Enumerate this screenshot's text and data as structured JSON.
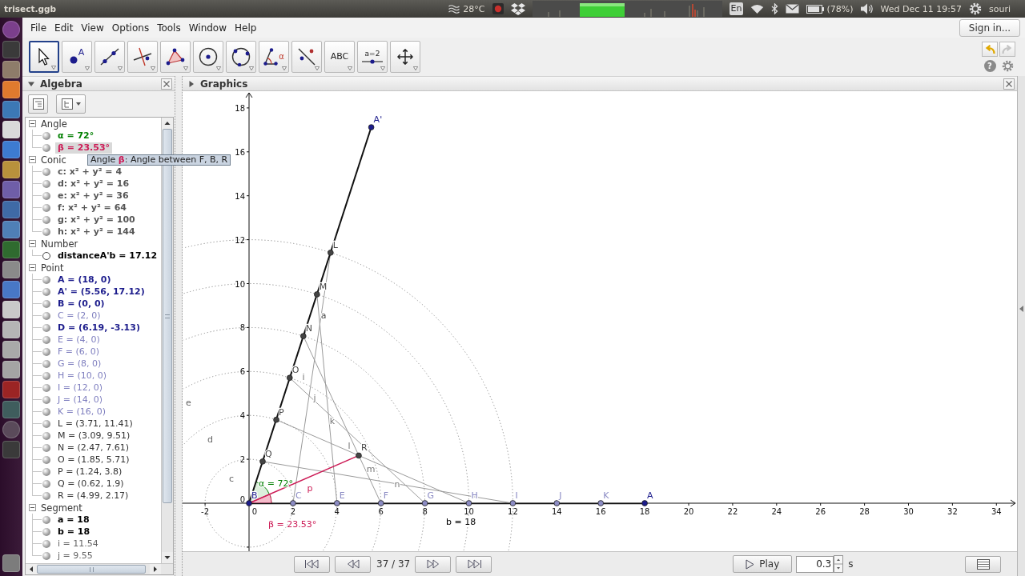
{
  "system_bar": {
    "title": "trisect.ggb",
    "temperature": "28°C",
    "keyboard_layout": "En",
    "battery": "(78%)",
    "clock": "Wed Dec 11 19:57",
    "user": "souri"
  },
  "menu": [
    "File",
    "Edit",
    "View",
    "Options",
    "Tools",
    "Window",
    "Help"
  ],
  "sign_in": "Sign in...",
  "tools": [
    {
      "kind": "move",
      "selected": true
    },
    {
      "kind": "point",
      "label": "A",
      "selected": false
    },
    {
      "kind": "line",
      "selected": false
    },
    {
      "kind": "perpendicular",
      "selected": false
    },
    {
      "kind": "polygon",
      "selected": false
    },
    {
      "kind": "circle_center",
      "selected": false
    },
    {
      "kind": "circle_three",
      "selected": false
    },
    {
      "kind": "angle",
      "label": "α",
      "selected": false
    },
    {
      "kind": "reflect",
      "selected": false
    },
    {
      "kind": "text",
      "label": "ABC",
      "selected": false
    },
    {
      "kind": "slider",
      "label": "a=2",
      "selected": false
    },
    {
      "kind": "move_view",
      "selected": false
    }
  ],
  "help": "?",
  "algebra": {
    "title": "Algebra",
    "expanded": true,
    "groups": [
      {
        "name": "Angle",
        "expanded": true,
        "items": [
          {
            "text": "α = 72°",
            "color": "#007f00",
            "bold": true,
            "visible": true,
            "selected": false
          },
          {
            "text": "β = 23.53°",
            "color": "#cc1a55",
            "bold": true,
            "visible": true,
            "selected": true
          }
        ]
      },
      {
        "name": "Conic",
        "expanded": true,
        "items": [
          {
            "text": "c: x² + y² = 4",
            "color": "#555555",
            "bold": true,
            "visible": true,
            "selected": false
          },
          {
            "text": "d: x² + y² = 16",
            "color": "#555555",
            "bold": true,
            "visible": true,
            "selected": false
          },
          {
            "text": "e: x² + y² = 36",
            "color": "#555555",
            "bold": true,
            "visible": true,
            "selected": false
          },
          {
            "text": "f: x² + y² = 64",
            "color": "#555555",
            "bold": true,
            "visible": true,
            "selected": false
          },
          {
            "text": "g: x² + y² = 100",
            "color": "#555555",
            "bold": true,
            "visible": true,
            "selected": false
          },
          {
            "text": "h: x² + y² = 144",
            "color": "#555555",
            "bold": true,
            "visible": true,
            "selected": false
          }
        ]
      },
      {
        "name": "Number",
        "expanded": true,
        "items": [
          {
            "text": "distanceA'b = 17.12",
            "color": "#000000",
            "bold": true,
            "visible": false,
            "selected": false
          }
        ]
      },
      {
        "name": "Point",
        "expanded": true,
        "items": [
          {
            "text": "A = (18, 0)",
            "color": "#1c1c8c",
            "bold": true,
            "visible": true,
            "selected": false
          },
          {
            "text": "A' = (5.56, 17.12)",
            "color": "#1c1c8c",
            "bold": true,
            "visible": true,
            "selected": false
          },
          {
            "text": "B = (0, 0)",
            "color": "#1c1c8c",
            "bold": true,
            "visible": true,
            "selected": false
          },
          {
            "text": "C = (2, 0)",
            "color": "#7f7fbf",
            "bold": false,
            "visible": true,
            "selected": false
          },
          {
            "text": "D = (6.19, -3.13)",
            "color": "#1c1c8c",
            "bold": true,
            "visible": true,
            "selected": false
          },
          {
            "text": "E = (4, 0)",
            "color": "#7f7fbf",
            "bold": false,
            "visible": true,
            "selected": false
          },
          {
            "text": "F = (6, 0)",
            "color": "#7f7fbf",
            "bold": false,
            "visible": true,
            "selected": false
          },
          {
            "text": "G = (8, 0)",
            "color": "#7f7fbf",
            "bold": false,
            "visible": true,
            "selected": false
          },
          {
            "text": "H = (10, 0)",
            "color": "#7f7fbf",
            "bold": false,
            "visible": true,
            "selected": false
          },
          {
            "text": "I = (12, 0)",
            "color": "#7f7fbf",
            "bold": false,
            "visible": true,
            "selected": false
          },
          {
            "text": "J = (14, 0)",
            "color": "#7f7fbf",
            "bold": false,
            "visible": true,
            "selected": false
          },
          {
            "text": "K = (16, 0)",
            "color": "#7f7fbf",
            "bold": false,
            "visible": true,
            "selected": false
          },
          {
            "text": "L = (3.71, 11.41)",
            "color": "#333333",
            "bold": false,
            "visible": true,
            "selected": false
          },
          {
            "text": "M = (3.09, 9.51)",
            "color": "#333333",
            "bold": false,
            "visible": true,
            "selected": false
          },
          {
            "text": "N = (2.47, 7.61)",
            "color": "#333333",
            "bold": false,
            "visible": true,
            "selected": false
          },
          {
            "text": "O = (1.85, 5.71)",
            "color": "#333333",
            "bold": false,
            "visible": true,
            "selected": false
          },
          {
            "text": "P = (1.24, 3.8)",
            "color": "#333333",
            "bold": false,
            "visible": true,
            "selected": false
          },
          {
            "text": "Q = (0.62, 1.9)",
            "color": "#333333",
            "bold": false,
            "visible": true,
            "selected": false
          },
          {
            "text": "R = (4.99, 2.17)",
            "color": "#333333",
            "bold": false,
            "visible": true,
            "selected": false
          }
        ]
      },
      {
        "name": "Segment",
        "expanded": true,
        "items": [
          {
            "text": "a = 18",
            "color": "#000000",
            "bold": true,
            "visible": true,
            "selected": false
          },
          {
            "text": "b = 18",
            "color": "#000000",
            "bold": true,
            "visible": true,
            "selected": false
          },
          {
            "text": "i = 11.54",
            "color": "#666666",
            "bold": false,
            "visible": true,
            "selected": false
          },
          {
            "text": "j = 9.55",
            "color": "#666666",
            "bold": false,
            "visible": true,
            "selected": false
          }
        ]
      }
    ]
  },
  "tooltip": "Angle **β**: Angle between F, B, R",
  "graphics": {
    "title": "Graphics",
    "expanded": false,
    "x_ticks": [
      "-2",
      "0",
      "2",
      "4",
      "6",
      "8",
      "10",
      "12",
      "14",
      "16",
      "18",
      "20",
      "22",
      "24",
      "26",
      "28",
      "30",
      "32",
      "34"
    ],
    "y_ticks": [
      "18",
      "16",
      "14",
      "12",
      "10",
      "8",
      "6",
      "4",
      "2",
      "0"
    ],
    "points": [
      {
        "label": "A'",
        "color": "#1c1c8c"
      },
      {
        "label": "L",
        "color": "#444444"
      },
      {
        "label": "M",
        "color": "#444444"
      },
      {
        "label": "N",
        "color": "#444444"
      },
      {
        "label": "O",
        "color": "#444444"
      },
      {
        "label": "P",
        "color": "#444444"
      },
      {
        "label": "Q",
        "color": "#444444"
      },
      {
        "label": "R",
        "color": "#444444"
      },
      {
        "label": "B",
        "color": "#1c1c8c"
      },
      {
        "label": "C",
        "color": "#8c8cc4"
      },
      {
        "label": "E",
        "color": "#8c8cc4"
      },
      {
        "label": "F",
        "color": "#8c8cc4"
      },
      {
        "label": "G",
        "color": "#8c8cc4"
      },
      {
        "label": "H",
        "color": "#8c8cc4"
      },
      {
        "label": "I",
        "color": "#8c8cc4"
      },
      {
        "label": "J",
        "color": "#8c8cc4"
      },
      {
        "label": "K",
        "color": "#8c8cc4"
      },
      {
        "label": "A",
        "color": "#1c1c8c"
      }
    ],
    "object_labels": [
      "a",
      "b = 18",
      "p",
      "i",
      "j",
      "k",
      "l",
      "m",
      "n"
    ],
    "circle_labels": [
      "c",
      "d",
      "e"
    ],
    "angles": [
      {
        "label": "α = 72°",
        "color": "#007f00"
      },
      {
        "label": "β = 23.53°",
        "color": "#cc1a55"
      }
    ]
  },
  "animation": {
    "counter": "37 / 37",
    "play": "Play",
    "speed": "0.3",
    "unit": "s"
  }
}
